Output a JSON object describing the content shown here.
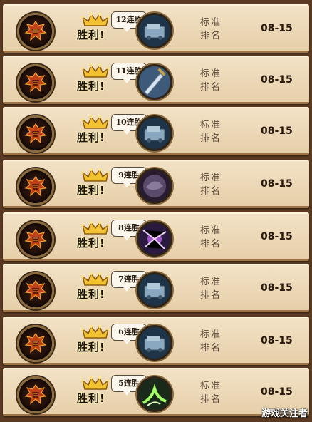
{
  "match_history": {
    "rows": [
      {
        "result": "胜利!",
        "streak": "12连胜",
        "card_icon": "mech-card-icon",
        "mode": [
          "标准",
          "排名"
        ],
        "date": "08-15"
      },
      {
        "result": "胜利!",
        "streak": "11连胜",
        "card_icon": "sword-card-icon",
        "mode": [
          "标准",
          "排名"
        ],
        "date": "08-15"
      },
      {
        "result": "胜利!",
        "streak": "10连胜",
        "card_icon": "mech-card-icon",
        "mode": [
          "标准",
          "排名"
        ],
        "date": "08-15"
      },
      {
        "result": "胜利!",
        "streak": "9连胜",
        "card_icon": "shadow-card-icon",
        "mode": [
          "标准",
          "排名"
        ],
        "date": "08-15"
      },
      {
        "result": "胜利!",
        "streak": "8连胜",
        "card_icon": "arcane-spell-card-icon",
        "mode": [
          "标准",
          "排名"
        ],
        "date": "08-15"
      },
      {
        "result": "胜利!",
        "streak": "7连胜",
        "card_icon": "mech-card-icon",
        "mode": [
          "标准",
          "排名"
        ],
        "date": "08-15"
      },
      {
        "result": "胜利!",
        "streak": "6连胜",
        "card_icon": "mech-card-icon",
        "mode": [
          "标准",
          "排名"
        ],
        "date": "08-15"
      },
      {
        "result": "胜利!",
        "streak": "5连胜",
        "card_icon": "nature-spell-card-icon",
        "mode": [
          "标准",
          "排名"
        ],
        "date": "08-15"
      }
    ]
  },
  "hero_icon": "horde-crest-icon",
  "watermark": "游戏关注者",
  "colors": {
    "row_background": "#efdcbd",
    "row_border": "#9c7447",
    "crown_gold": "#f2c230",
    "date_text": "#2a1a0e",
    "rank_text": "#5d4a3a"
  }
}
